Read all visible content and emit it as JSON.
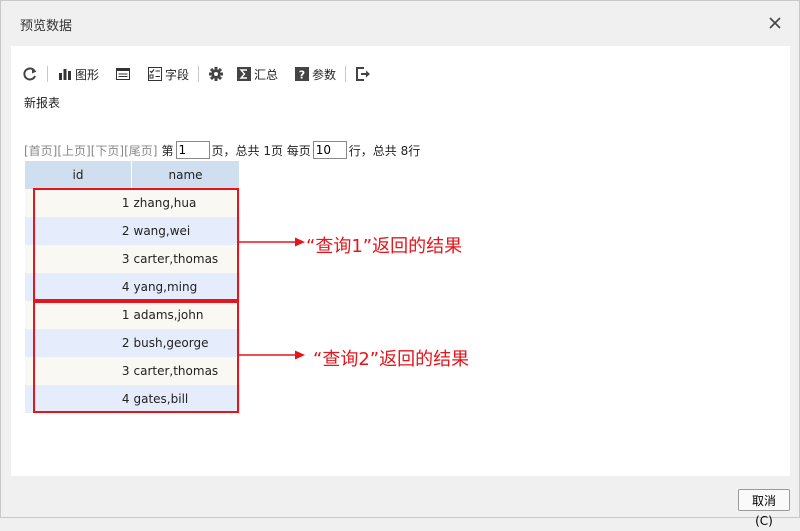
{
  "dialog": {
    "title": "预览数据"
  },
  "toolbar": {
    "refresh_icon": "refresh-icon",
    "chart_label": "图形",
    "layout_icon": "layout-icon",
    "fields_label": "字段",
    "settings_icon": "gear-icon",
    "summary_label": "汇总",
    "params_label": "参数",
    "export_icon": "export-icon"
  },
  "report": {
    "title": "新报表"
  },
  "pager": {
    "first": "[首页]",
    "prev": "[上页]",
    "next": "[下页]",
    "last": "[尾页]",
    "page_prefix": "第",
    "page_value": "1",
    "page_suffix": "页，总共 1页 每页",
    "rows_value": "10",
    "rows_suffix": "行，总共 8行"
  },
  "table": {
    "columns": [
      "id",
      "name"
    ],
    "rows": [
      {
        "id": "1",
        "name": "zhang,hua"
      },
      {
        "id": "2",
        "name": "wang,wei"
      },
      {
        "id": "3",
        "name": "carter,thomas"
      },
      {
        "id": "4",
        "name": "yang,ming"
      },
      {
        "id": "1",
        "name": "adams,john"
      },
      {
        "id": "2",
        "name": "bush,george"
      },
      {
        "id": "3",
        "name": "carter,thomas"
      },
      {
        "id": "4",
        "name": "gates,bill"
      }
    ]
  },
  "annotations": {
    "query1": "“查询1”返回的结果",
    "query2": "“查询2”返回的结果",
    "color": "#e5151b"
  },
  "footer": {
    "cancel_label": "取消(C)"
  }
}
